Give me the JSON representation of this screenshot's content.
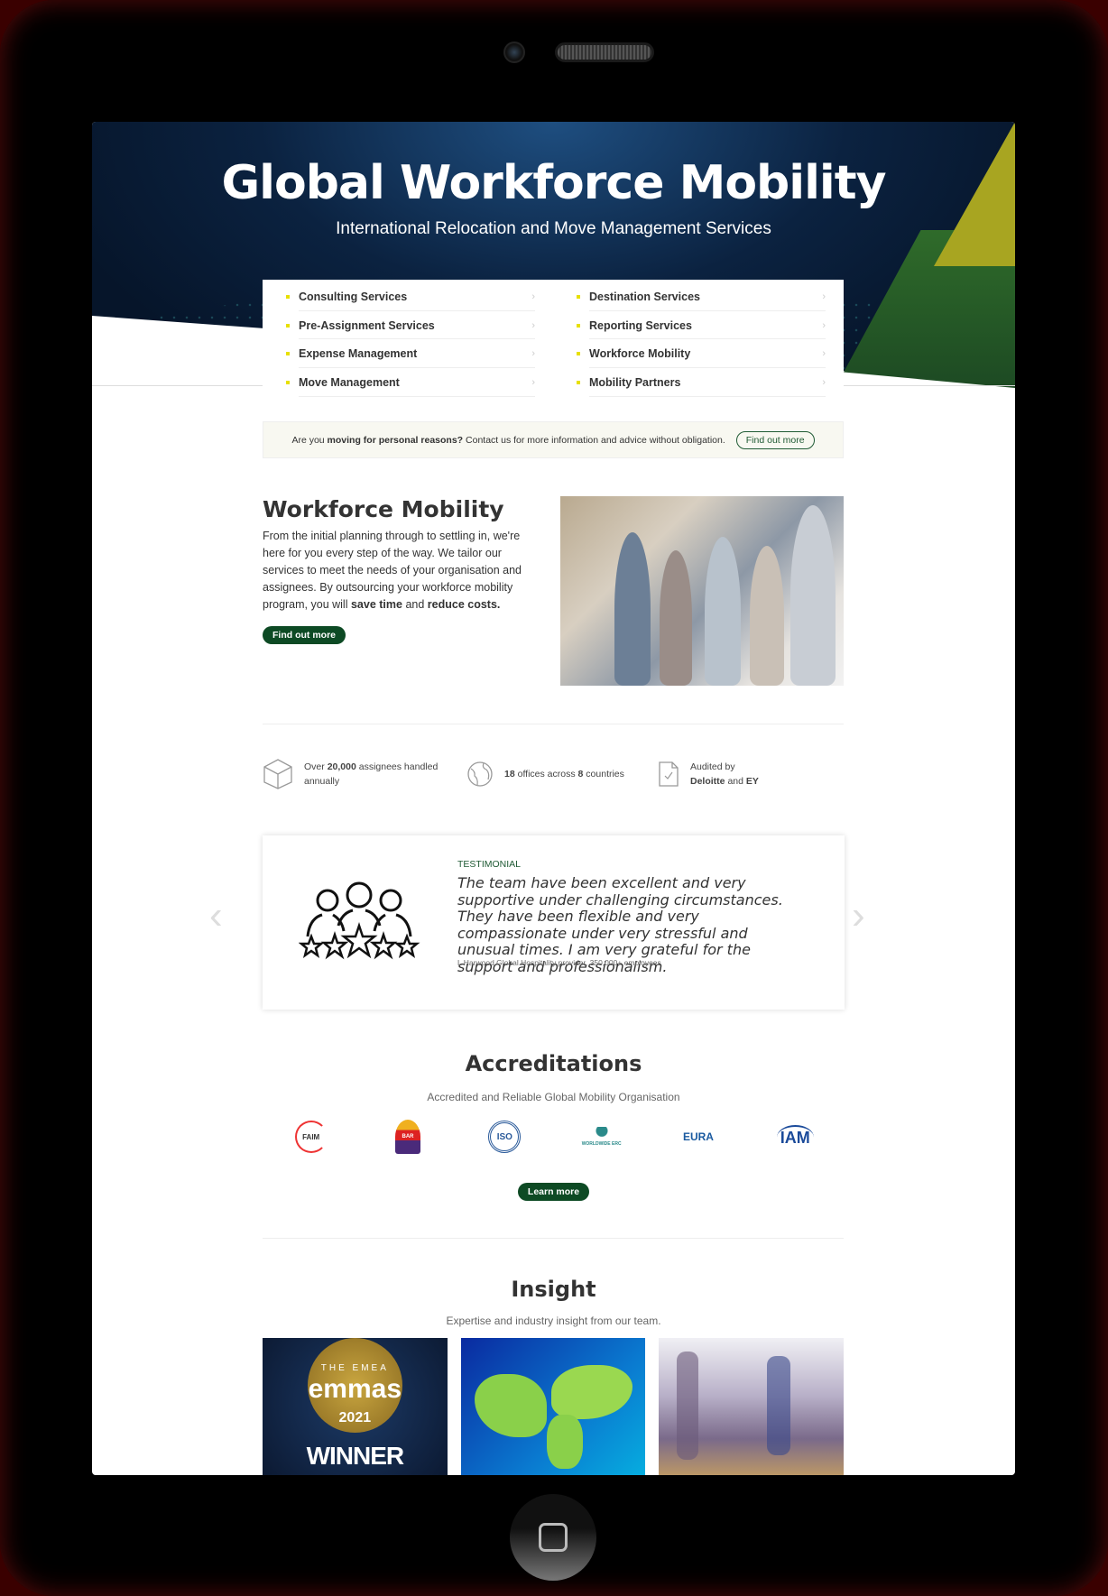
{
  "hero": {
    "title": "Global Workforce Mobility",
    "subtitle": "International Relocation and Move Management Services"
  },
  "services": [
    {
      "label": "Consulting Services"
    },
    {
      "label": "Destination Services"
    },
    {
      "label": "Pre-Assignment Services"
    },
    {
      "label": "Reporting Services"
    },
    {
      "label": "Expense Management"
    },
    {
      "label": "Workforce Mobility"
    },
    {
      "label": "Move Management"
    },
    {
      "label": "Mobility Partners"
    }
  ],
  "banner": {
    "prefix": "Are you",
    "bold": "moving for personal reasons?",
    "suffix": "Contact us for more information and advice without obligation.",
    "button": "Find out more"
  },
  "workforce": {
    "heading": "Workforce Mobility",
    "text": "From the initial planning through to settling in, we're here for you every step of the way. We tailor our services to meet the needs of your organisation and assignees. By outsourcing your workforce mobility program, you will",
    "bold1": "save time",
    "and": "and",
    "bold2": "reduce costs.",
    "button": "Find out more"
  },
  "stats": [
    {
      "icon": "box-icon",
      "pre": "Over",
      "bold": "20,000",
      "post": "assignees handled annually"
    },
    {
      "icon": "globe-icon",
      "bold": "18",
      "post": "offices across",
      "bold2": "8",
      "post2": "countries"
    },
    {
      "icon": "document-check-icon",
      "pre": "Audited by",
      "bold": "Deloitte",
      "post": "and",
      "bold2": "EY"
    }
  ],
  "testimonial": {
    "label": "TESTIMONIAL",
    "quote": "The team have been excellent and very supportive under challenging circumstances. They have been flexible and very compassionate under very stressful and unusual times. I am very grateful for the support and professionalism.",
    "author": "L Harwood Global Hospitality provider, 350,000+ employees"
  },
  "accreditations": {
    "title": "Accreditations",
    "subtitle": "Accredited and Reliable Global Mobility Organisation",
    "logos": [
      "FAIM",
      "BAR",
      "ISO",
      "WORLDWIDE ERC",
      "EURA",
      "IAM"
    ],
    "button": "Learn more"
  },
  "insight": {
    "title": "Insight",
    "subtitle": "Expertise and industry insight from our team.",
    "card1": {
      "line1": "THE EMEA",
      "line2": "emmas",
      "line3": "2021",
      "line4": "WINNER"
    }
  },
  "colors": {
    "brand_green": "#0d4a24",
    "accent_yellow": "#e8e000",
    "hero_navy": "#0b2240"
  }
}
